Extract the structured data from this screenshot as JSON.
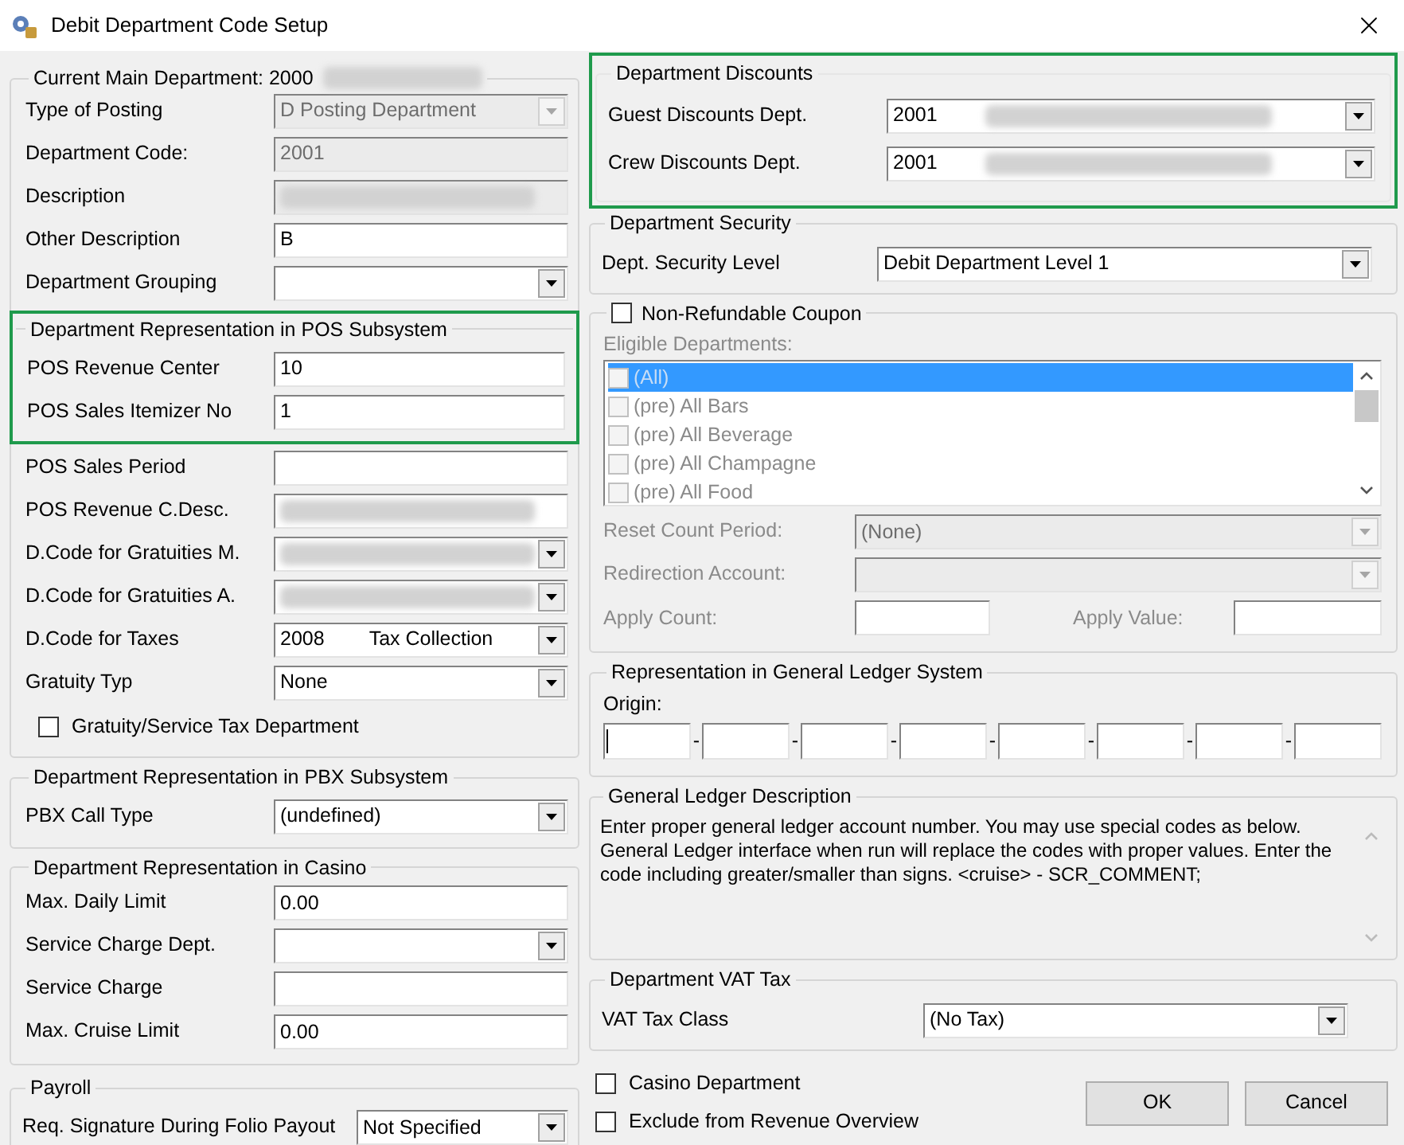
{
  "window": {
    "title": "Debit Department Code Setup"
  },
  "main_group": {
    "title": "Current Main Department: 2000",
    "title_blurred": true,
    "fields": [
      {
        "label": "Type of Posting",
        "kind": "combo",
        "value": "D Posting Department",
        "disabled": true,
        "blurred": false
      },
      {
        "label": "Department Code:",
        "kind": "text",
        "value": "2001",
        "disabled": true,
        "blurred": false
      },
      {
        "label": "Description",
        "kind": "text",
        "disabled": true,
        "blurred": true
      },
      {
        "label": "Other Description",
        "kind": "text",
        "value": "B",
        "disabled": false,
        "blurred": false
      },
      {
        "label": "Department Grouping",
        "kind": "combo",
        "disabled": false,
        "blurred": false
      }
    ],
    "pos_group": {
      "title": "Department Representation in POS Subsystem",
      "highlighted": true,
      "fields": [
        {
          "label": "POS Revenue Center",
          "kind": "text",
          "value": "10",
          "disabled": false,
          "blurred": false
        },
        {
          "label": "POS Sales Itemizer No",
          "kind": "text",
          "value": "1",
          "disabled": false,
          "blurred": false
        }
      ]
    },
    "more_fields": [
      {
        "label": "POS Sales Period",
        "kind": "text",
        "disabled": false,
        "blurred": false
      },
      {
        "label": "POS Revenue C.Desc.",
        "kind": "text",
        "disabled": false,
        "blurred": true
      },
      {
        "label": "D.Code for Gratuities M.",
        "kind": "combo",
        "disabled": false,
        "blurred": true
      },
      {
        "label": "D.Code for Gratuities A.",
        "kind": "combo",
        "disabled": false,
        "blurred": true
      },
      {
        "label": "D.Code for Taxes",
        "kind": "combo",
        "value": "2008",
        "description": "Tax Collection",
        "disabled": false,
        "blurred": false
      },
      {
        "label": "Gratuity Typ",
        "kind": "combo",
        "value": "None",
        "disabled": false,
        "blurred": false
      }
    ],
    "checkbox": {
      "label": "Gratuity/Service Tax Department",
      "checked": false
    }
  },
  "pbx_group": {
    "title": "Department Representation in PBX Subsystem",
    "fields": [
      {
        "label": "PBX Call Type",
        "kind": "combo",
        "value": "(undefined)",
        "disabled": false,
        "blurred": false
      }
    ]
  },
  "casino_group": {
    "title": "Department Representation in Casino",
    "fields": [
      {
        "label": "Max. Daily Limit",
        "kind": "text",
        "value": "0.00",
        "disabled": false,
        "blurred": false
      },
      {
        "label": "Service Charge Dept.",
        "kind": "combo",
        "disabled": false,
        "blurred": false
      },
      {
        "label": "Service Charge",
        "kind": "text",
        "disabled": false,
        "blurred": false
      },
      {
        "label": "Max. Cruise Limit",
        "kind": "text",
        "value": "0.00",
        "disabled": false,
        "blurred": false
      }
    ]
  },
  "payroll_group": {
    "title": "Payroll",
    "fields": [
      {
        "label": "Req. Signature During Folio Payout",
        "kind": "combo",
        "value": "Not Specified",
        "disabled": false,
        "blurred": false
      }
    ]
  },
  "discounts_group": {
    "title": "Department Discounts",
    "highlighted": true,
    "fields": [
      {
        "label": "Guest Discounts Dept.",
        "kind": "combo",
        "value": "2001",
        "disabled": false,
        "blurred": true
      },
      {
        "label": "Crew Discounts Dept.",
        "kind": "combo",
        "value": "2001",
        "disabled": false,
        "blurred": true
      }
    ]
  },
  "security_group": {
    "title": "Department Security",
    "fields": [
      {
        "label": "Dept. Security Level",
        "kind": "combo",
        "value": "Debit Department Level 1",
        "disabled": false,
        "blurred": false
      }
    ]
  },
  "coupon_group": {
    "title": "Non-Refundable Coupon",
    "checked": false,
    "disabled": true,
    "list_label": "Eligible Departments:",
    "items": [
      {
        "label": "(All)",
        "checked": false,
        "selected": true
      },
      {
        "label": "(pre) All Bars",
        "checked": false,
        "selected": false
      },
      {
        "label": "(pre) All Beverage",
        "checked": false,
        "selected": false
      },
      {
        "label": "(pre) All Champagne",
        "checked": false,
        "selected": false
      },
      {
        "label": "(pre) All Food",
        "checked": false,
        "selected": false
      }
    ],
    "fields": [
      {
        "label": "Reset Count Period:",
        "kind": "combo",
        "value": "(None)",
        "disabled": true,
        "blurred": false
      },
      {
        "label": "Redirection Account:",
        "kind": "combo",
        "disabled": true,
        "blurred": false
      }
    ],
    "apply_count_label": "Apply Count:",
    "apply_value_label": "Apply Value:"
  },
  "gl_group": {
    "title": "Representation in General Ledger System",
    "origin_label": "Origin:",
    "separators": [
      "-",
      "-",
      "-",
      "-",
      "-",
      "-",
      "-"
    ]
  },
  "gl_description": {
    "title": "General Ledger Description",
    "text": "Enter proper general ledger account number. You may use special codes as below. General Ledger interface when run will replace the codes with proper values. Enter the code including greater/smaller than signs. <cruise> - SCR_COMMENT;"
  },
  "vat_group": {
    "title": "Department VAT Tax",
    "fields": [
      {
        "label": "VAT Tax Class",
        "kind": "combo",
        "value": "(No Tax)",
        "disabled": false,
        "blurred": false
      }
    ]
  },
  "options": [
    {
      "label": "Casino Department",
      "checked": false
    },
    {
      "label": "Exclude from Revenue Overview",
      "checked": false
    }
  ],
  "buttons": [
    "OK",
    "Cancel"
  ]
}
